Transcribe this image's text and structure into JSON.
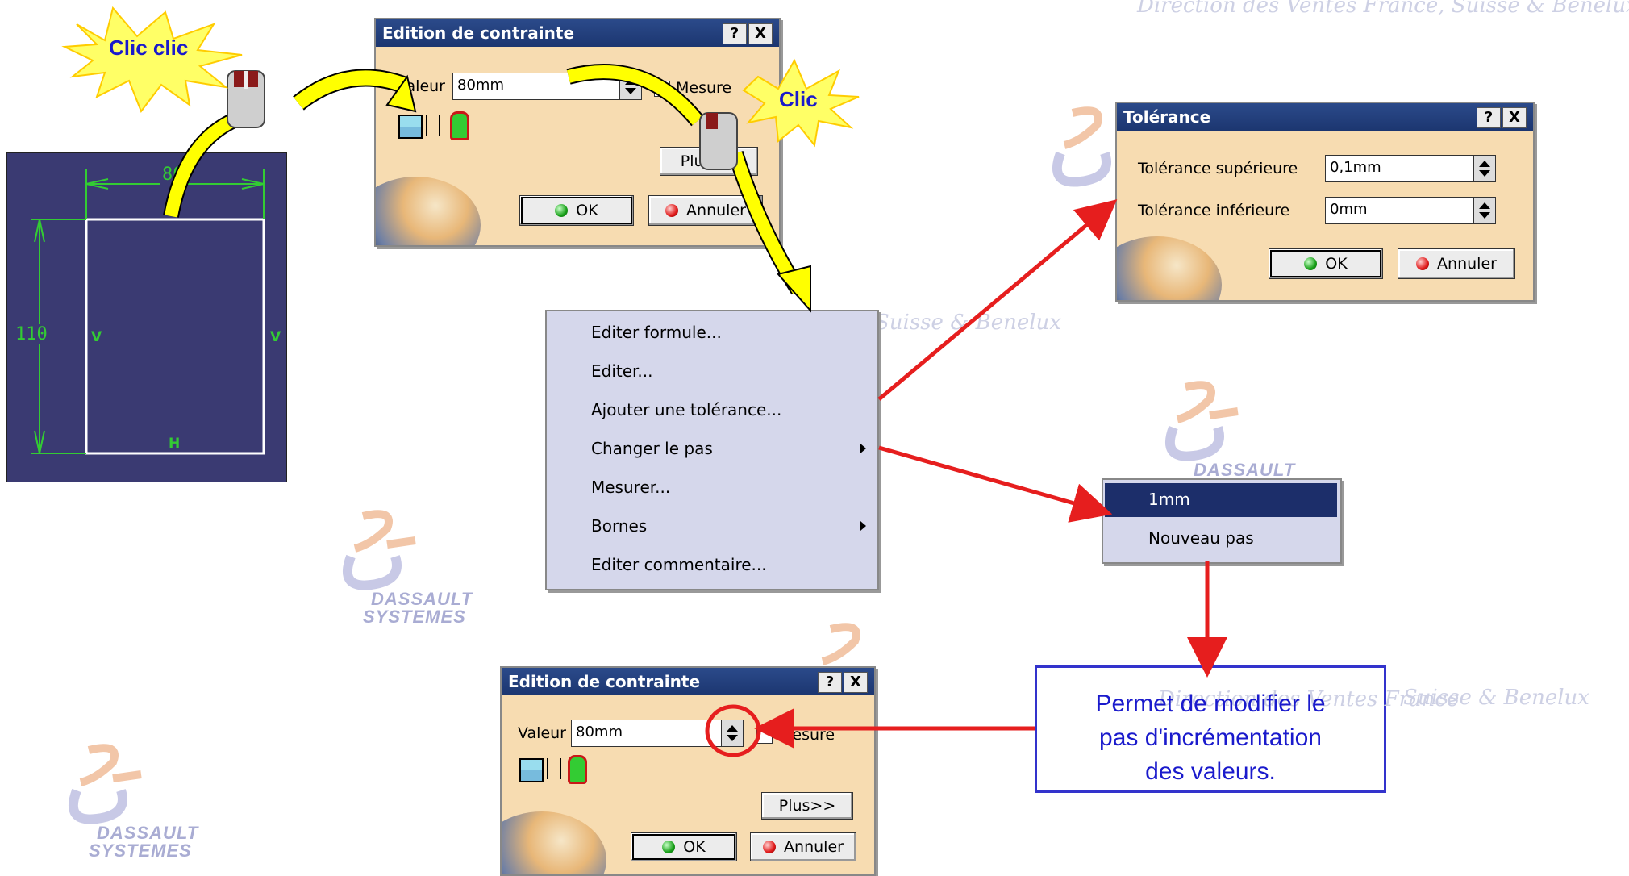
{
  "watermark": {
    "top_text": "Direction des Ventes France, Suisse & Benelux",
    "mid_text": "Suisse & Benelux",
    "right_text": "Suisse & Benelux",
    "callout_overlay_text": "Direction des Ventes France",
    "logo_word_1": "DASSAULT",
    "logo_word_2": "SYSTEMES"
  },
  "bursts": {
    "clic_clic": "Clic clic",
    "clic": "Clic"
  },
  "sketch": {
    "dim_horizontal": "80",
    "dim_vertical": "110",
    "constraint_h": "H",
    "constraint_v": "V"
  },
  "dialog_top": {
    "title": "Edition de contrainte",
    "help": "?",
    "close": "X",
    "valeur_label": "Valeur",
    "valeur_value": "80mm",
    "mesure_label": "Mesure",
    "plus_label": "Plus>>",
    "ok_label": "OK",
    "annuler_label": "Annuler"
  },
  "menu": {
    "items": [
      "Editer formule...",
      "Editer...",
      "Ajouter une tolérance...",
      "Changer le pas",
      "Mesurer...",
      "Bornes",
      "Editer commentaire..."
    ]
  },
  "tolerance_dialog": {
    "title": "Tolérance",
    "help": "?",
    "close": "X",
    "sup_label": "Tolérance supérieure",
    "sup_value": "0,1mm",
    "inf_label": "Tolérance inférieure",
    "inf_value": "0mm",
    "ok_label": "OK",
    "annuler_label": "Annuler"
  },
  "step_menu": {
    "items": [
      "1mm",
      "Nouveau pas"
    ],
    "selected_index": 0,
    "selected_color": "#1c2e6a"
  },
  "dialog_bottom": {
    "title": "Edition de contrainte",
    "help": "?",
    "close": "X",
    "valeur_label": "Valeur",
    "valeur_value": "80mm",
    "mesure_label": "Mesure",
    "plus_label": "Plus>>",
    "ok_label": "OK",
    "annuler_label": "Annuler"
  },
  "callout": {
    "line1": "Permet de modifier le",
    "line2": "pas d'incrémentation",
    "line3": "des valeurs."
  },
  "colors": {
    "arrow_red": "#e61e1e",
    "arrow_yellow": "#ffff00",
    "dialog_bg": "#f7dcb1",
    "titlebar": "#1c3670",
    "callout_border": "#3333cc",
    "sketch_bg": "#3a3a72",
    "sketch_green": "#33cc33"
  }
}
